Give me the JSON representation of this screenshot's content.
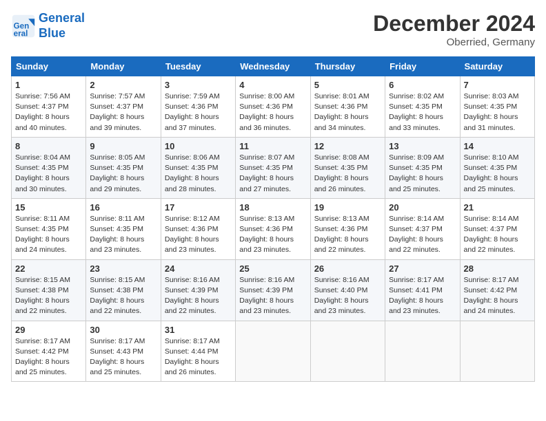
{
  "header": {
    "logo_line1": "General",
    "logo_line2": "Blue",
    "title": "December 2024",
    "subtitle": "Oberried, Germany"
  },
  "days_of_week": [
    "Sunday",
    "Monday",
    "Tuesday",
    "Wednesday",
    "Thursday",
    "Friday",
    "Saturday"
  ],
  "weeks": [
    [
      {
        "day": "1",
        "lines": [
          "Sunrise: 7:56 AM",
          "Sunset: 4:37 PM",
          "Daylight: 8 hours",
          "and 40 minutes."
        ]
      },
      {
        "day": "2",
        "lines": [
          "Sunrise: 7:57 AM",
          "Sunset: 4:37 PM",
          "Daylight: 8 hours",
          "and 39 minutes."
        ]
      },
      {
        "day": "3",
        "lines": [
          "Sunrise: 7:59 AM",
          "Sunset: 4:36 PM",
          "Daylight: 8 hours",
          "and 37 minutes."
        ]
      },
      {
        "day": "4",
        "lines": [
          "Sunrise: 8:00 AM",
          "Sunset: 4:36 PM",
          "Daylight: 8 hours",
          "and 36 minutes."
        ]
      },
      {
        "day": "5",
        "lines": [
          "Sunrise: 8:01 AM",
          "Sunset: 4:36 PM",
          "Daylight: 8 hours",
          "and 34 minutes."
        ]
      },
      {
        "day": "6",
        "lines": [
          "Sunrise: 8:02 AM",
          "Sunset: 4:35 PM",
          "Daylight: 8 hours",
          "and 33 minutes."
        ]
      },
      {
        "day": "7",
        "lines": [
          "Sunrise: 8:03 AM",
          "Sunset: 4:35 PM",
          "Daylight: 8 hours",
          "and 31 minutes."
        ]
      }
    ],
    [
      {
        "day": "8",
        "lines": [
          "Sunrise: 8:04 AM",
          "Sunset: 4:35 PM",
          "Daylight: 8 hours",
          "and 30 minutes."
        ]
      },
      {
        "day": "9",
        "lines": [
          "Sunrise: 8:05 AM",
          "Sunset: 4:35 PM",
          "Daylight: 8 hours",
          "and 29 minutes."
        ]
      },
      {
        "day": "10",
        "lines": [
          "Sunrise: 8:06 AM",
          "Sunset: 4:35 PM",
          "Daylight: 8 hours",
          "and 28 minutes."
        ]
      },
      {
        "day": "11",
        "lines": [
          "Sunrise: 8:07 AM",
          "Sunset: 4:35 PM",
          "Daylight: 8 hours",
          "and 27 minutes."
        ]
      },
      {
        "day": "12",
        "lines": [
          "Sunrise: 8:08 AM",
          "Sunset: 4:35 PM",
          "Daylight: 8 hours",
          "and 26 minutes."
        ]
      },
      {
        "day": "13",
        "lines": [
          "Sunrise: 8:09 AM",
          "Sunset: 4:35 PM",
          "Daylight: 8 hours",
          "and 25 minutes."
        ]
      },
      {
        "day": "14",
        "lines": [
          "Sunrise: 8:10 AM",
          "Sunset: 4:35 PM",
          "Daylight: 8 hours",
          "and 25 minutes."
        ]
      }
    ],
    [
      {
        "day": "15",
        "lines": [
          "Sunrise: 8:11 AM",
          "Sunset: 4:35 PM",
          "Daylight: 8 hours",
          "and 24 minutes."
        ]
      },
      {
        "day": "16",
        "lines": [
          "Sunrise: 8:11 AM",
          "Sunset: 4:35 PM",
          "Daylight: 8 hours",
          "and 23 minutes."
        ]
      },
      {
        "day": "17",
        "lines": [
          "Sunrise: 8:12 AM",
          "Sunset: 4:36 PM",
          "Daylight: 8 hours",
          "and 23 minutes."
        ]
      },
      {
        "day": "18",
        "lines": [
          "Sunrise: 8:13 AM",
          "Sunset: 4:36 PM",
          "Daylight: 8 hours",
          "and 23 minutes."
        ]
      },
      {
        "day": "19",
        "lines": [
          "Sunrise: 8:13 AM",
          "Sunset: 4:36 PM",
          "Daylight: 8 hours",
          "and 22 minutes."
        ]
      },
      {
        "day": "20",
        "lines": [
          "Sunrise: 8:14 AM",
          "Sunset: 4:37 PM",
          "Daylight: 8 hours",
          "and 22 minutes."
        ]
      },
      {
        "day": "21",
        "lines": [
          "Sunrise: 8:14 AM",
          "Sunset: 4:37 PM",
          "Daylight: 8 hours",
          "and 22 minutes."
        ]
      }
    ],
    [
      {
        "day": "22",
        "lines": [
          "Sunrise: 8:15 AM",
          "Sunset: 4:38 PM",
          "Daylight: 8 hours",
          "and 22 minutes."
        ]
      },
      {
        "day": "23",
        "lines": [
          "Sunrise: 8:15 AM",
          "Sunset: 4:38 PM",
          "Daylight: 8 hours",
          "and 22 minutes."
        ]
      },
      {
        "day": "24",
        "lines": [
          "Sunrise: 8:16 AM",
          "Sunset: 4:39 PM",
          "Daylight: 8 hours",
          "and 22 minutes."
        ]
      },
      {
        "day": "25",
        "lines": [
          "Sunrise: 8:16 AM",
          "Sunset: 4:39 PM",
          "Daylight: 8 hours",
          "and 23 minutes."
        ]
      },
      {
        "day": "26",
        "lines": [
          "Sunrise: 8:16 AM",
          "Sunset: 4:40 PM",
          "Daylight: 8 hours",
          "and 23 minutes."
        ]
      },
      {
        "day": "27",
        "lines": [
          "Sunrise: 8:17 AM",
          "Sunset: 4:41 PM",
          "Daylight: 8 hours",
          "and 23 minutes."
        ]
      },
      {
        "day": "28",
        "lines": [
          "Sunrise: 8:17 AM",
          "Sunset: 4:42 PM",
          "Daylight: 8 hours",
          "and 24 minutes."
        ]
      }
    ],
    [
      {
        "day": "29",
        "lines": [
          "Sunrise: 8:17 AM",
          "Sunset: 4:42 PM",
          "Daylight: 8 hours",
          "and 25 minutes."
        ]
      },
      {
        "day": "30",
        "lines": [
          "Sunrise: 8:17 AM",
          "Sunset: 4:43 PM",
          "Daylight: 8 hours",
          "and 25 minutes."
        ]
      },
      {
        "day": "31",
        "lines": [
          "Sunrise: 8:17 AM",
          "Sunset: 4:44 PM",
          "Daylight: 8 hours",
          "and 26 minutes."
        ]
      },
      {
        "day": "",
        "lines": []
      },
      {
        "day": "",
        "lines": []
      },
      {
        "day": "",
        "lines": []
      },
      {
        "day": "",
        "lines": []
      }
    ]
  ]
}
